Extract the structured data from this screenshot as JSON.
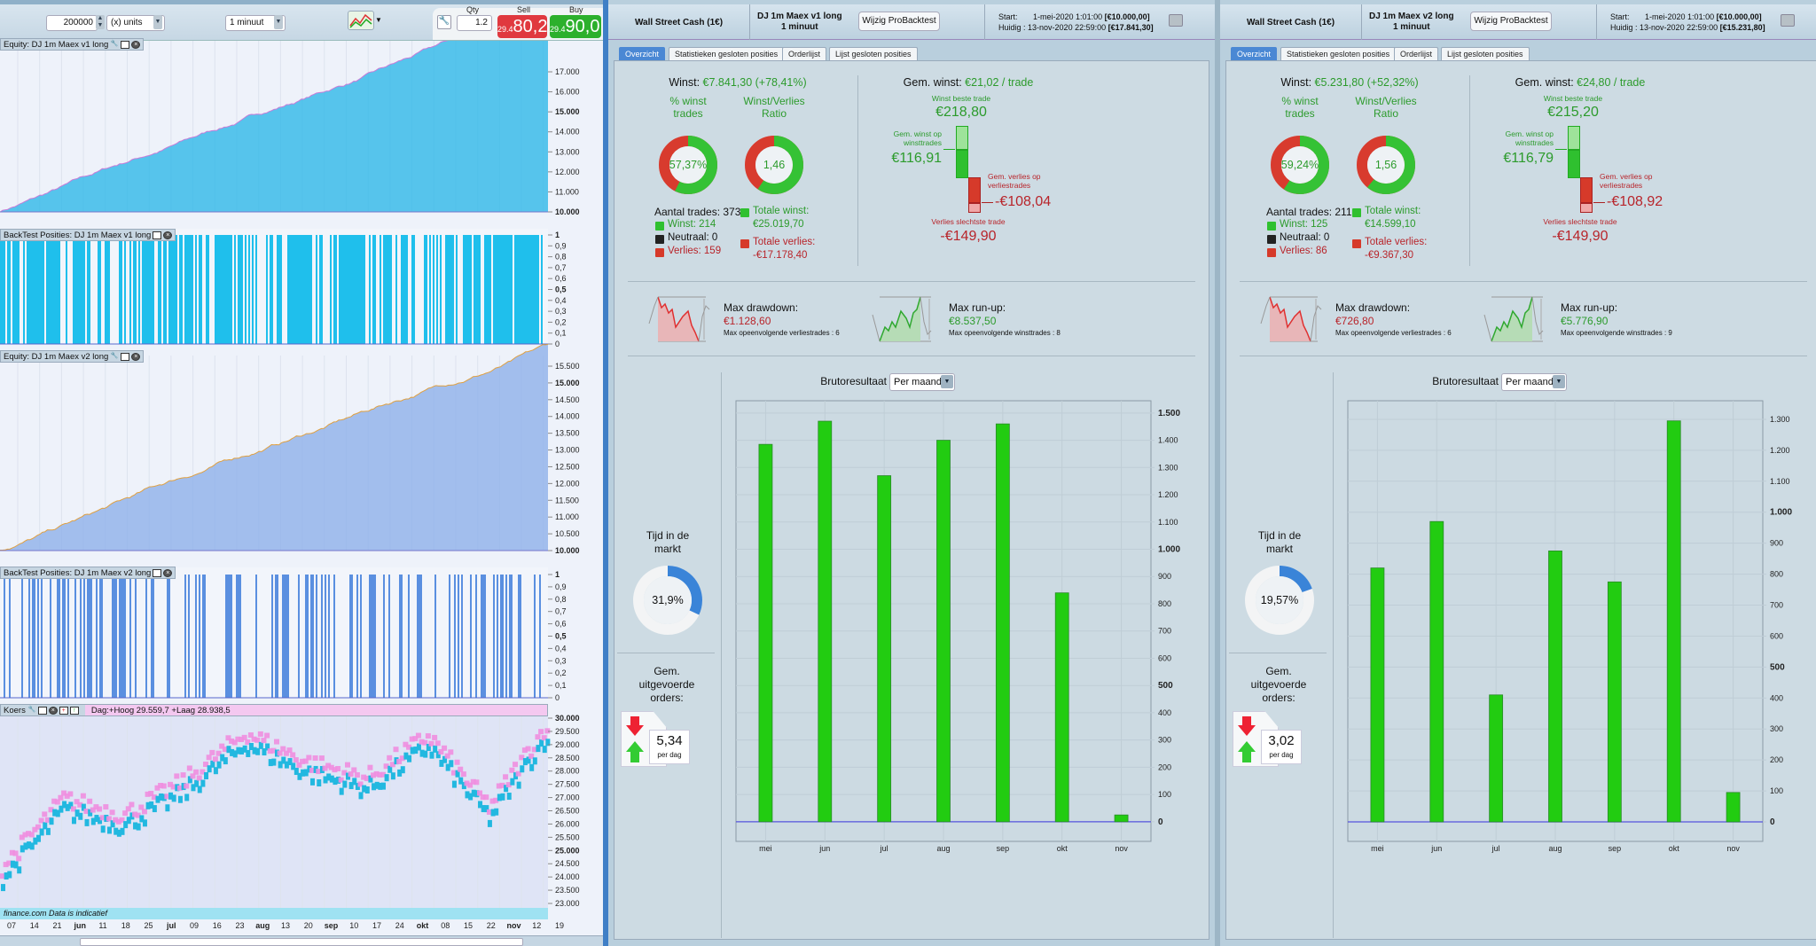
{
  "toolbar": {
    "quantity": "200000",
    "units": "(x) units",
    "timeframe": "1 minuut",
    "qty_label": "Qty",
    "qty_value": "1.2",
    "sell_label": "Sell",
    "buy_label": "Buy",
    "sell_prefix": "29.4",
    "sell_price": "80,2",
    "buy_prefix": "29.4",
    "buy_price": "90,0"
  },
  "left_charts": {
    "equity_v1_title": "Equity: DJ 1m Maex v1 long",
    "equity_v1_ticks": [
      "17.000",
      "16.000",
      "15.000",
      "14.000",
      "13.000",
      "12.000",
      "11.000",
      "10.000"
    ],
    "positions_v1_title": "BackTest Posities: DJ 1m Maex v1 long",
    "positions_ticks": [
      "1",
      "0,9",
      "0,8",
      "0,7",
      "0,6",
      "0,5",
      "0,4",
      "0,3",
      "0,2",
      "0,1",
      "0"
    ],
    "equity_v2_title": "Equity: DJ 1m Maex v2 long",
    "equity_v2_ticks": [
      "15.500",
      "15.000",
      "14.500",
      "14.000",
      "13.500",
      "13.000",
      "12.500",
      "12.000",
      "11.500",
      "11.000",
      "10.500",
      "10.000"
    ],
    "positions_v2_title": "BackTest Posities: DJ 1m Maex v2 long",
    "price_title": "Koers",
    "price_info": "Dag:+Hoog 29.559,7 +Laag 28.938,5",
    "price_ticks": [
      "30.000",
      "29.500",
      "29.000",
      "28.500",
      "28.000",
      "27.500",
      "27.000",
      "26.500",
      "26.000",
      "25.500",
      "25.000",
      "24.500",
      "24.000",
      "23.500",
      "23.000"
    ],
    "footer_note": "finance.com  Data is indicatief",
    "date_ticks": [
      "07",
      "14",
      "21",
      "jun",
      "11",
      "18",
      "25",
      "jul",
      "09",
      "16",
      "23",
      "aug",
      "13",
      "20",
      "sep",
      "10",
      "17",
      "24",
      "okt",
      "08",
      "15",
      "22",
      "nov",
      "12",
      "19"
    ],
    "colors": {
      "equity_v1": "#2fb8e8",
      "equity_v2": "#8fb0ea",
      "positions_v1": "#1fbfec",
      "positions_v2": "#5a8fe0",
      "candles_up": "#f08ee0",
      "candles_down": "#22b8e0"
    }
  },
  "panels": [
    {
      "instrument": "Wall Street Cash (1€)",
      "system": "DJ 1m Maex v1 long",
      "timeframe": "1 minuut",
      "edit_button": "Wijzig ProBacktest",
      "start_label": "Start:",
      "start_value": "1-mei-2020 1:01:00",
      "start_capital": "[€10.000,00]",
      "current_label": "Huidig :",
      "current_value": "13-nov-2020 22:59:00",
      "current_capital": "[€17.841,30]",
      "tabs": [
        "Overzicht",
        "Statistieken gesloten posities",
        "Orderlijst",
        "Lijst gesloten posities"
      ],
      "profit_label": "Winst:",
      "profit_value": "€7.841,30 (+78,41%)",
      "win_pct_title_1": "% winst",
      "win_pct_title_2": "trades",
      "win_pct": "57,37%",
      "win_fraction": 0.5737,
      "ratio_title_1": "Winst/Verlies",
      "ratio_title_2": "Ratio",
      "ratio": "1,46",
      "ratio_value": 1.46,
      "trades_count": "Aantal trades: 373",
      "wins": "Winst: 214",
      "neutral": "Neutraal: 0",
      "losses": "Verlies: 159",
      "total_win_label": "Totale winst:",
      "total_win": "€25.019,70",
      "total_loss_label": "Totale verlies:",
      "total_loss": "-€17.178,40",
      "avg_profit_label": "Gem. winst:",
      "avg_profit": "€21,02 / trade",
      "best_trade_label": "Winst beste trade",
      "best_trade": "€218,80",
      "avg_win_label_1": "Gem. winst op",
      "avg_win_label_2": "winsttrades",
      "avg_win": "€116,91",
      "avg_loss_label_1": "Gem. verlies op",
      "avg_loss_label_2": "verliestrades",
      "avg_loss": "-€108,04",
      "worst_trade_label": "Verlies slechtste trade",
      "worst_trade": "-€149,90",
      "drawdown_label": "Max drawdown:",
      "drawdown": "€1.128,60",
      "drawdown_sub": "Max opeenvolgende verliestrades : 6",
      "runup_label": "Max run-up:",
      "runup": "€8.537,50",
      "runup_sub": "Max opeenvolgende winsttrades : 8",
      "time_in_market_1": "Tijd in de",
      "time_in_market_2": "markt",
      "time_in_market": "31,9%",
      "time_in_market_fraction": 0.319,
      "orders_label_1": "Gem.",
      "orders_label_2": "uitgevoerde",
      "orders_label_3": "orders:",
      "orders_per_day": "5,34",
      "orders_unit": "per dag",
      "chart_title": "Brutoresultaat",
      "chart_period": "Per maand"
    },
    {
      "instrument": "Wall Street Cash (1€)",
      "system": "DJ 1m Maex v2 long",
      "timeframe": "1 minuut",
      "edit_button": "Wijzig ProBacktest",
      "start_label": "Start:",
      "start_value": "1-mei-2020 1:01:00",
      "start_capital": "[€10.000,00]",
      "current_label": "Huidig :",
      "current_value": "13-nov-2020 22:59:00",
      "current_capital": "[€15.231,80]",
      "tabs": [
        "Overzicht",
        "Statistieken gesloten posities",
        "Orderlijst",
        "Lijst gesloten posities"
      ],
      "profit_label": "Winst:",
      "profit_value": "€5.231,80 (+52,32%)",
      "win_pct_title_1": "% winst",
      "win_pct_title_2": "trades",
      "win_pct": "59,24%",
      "win_fraction": 0.5924,
      "ratio_title_1": "Winst/Verlies",
      "ratio_title_2": "Ratio",
      "ratio": "1,56",
      "ratio_value": 1.56,
      "trades_count": "Aantal trades: 211",
      "wins": "Winst: 125",
      "neutral": "Neutraal: 0",
      "losses": "Verlies: 86",
      "total_win_label": "Totale winst:",
      "total_win": "€14.599,10",
      "total_loss_label": "Totale verlies:",
      "total_loss": "-€9.367,30",
      "avg_profit_label": "Gem. winst:",
      "avg_profit": "€24,80 / trade",
      "best_trade_label": "Winst beste trade",
      "best_trade": "€215,20",
      "avg_win_label_1": "Gem. winst op",
      "avg_win_label_2": "winsttrades",
      "avg_win": "€116,79",
      "avg_loss_label_1": "Gem. verlies op",
      "avg_loss_label_2": "verliestrades",
      "avg_loss": "-€108,92",
      "worst_trade_label": "Verlies slechtste trade",
      "worst_trade": "-€149,90",
      "drawdown_label": "Max drawdown:",
      "drawdown": "€726,80",
      "drawdown_sub": "Max opeenvolgende verliestrades : 6",
      "runup_label": "Max run-up:",
      "runup": "€5.776,90",
      "runup_sub": "Max opeenvolgende winsttrades : 9",
      "time_in_market_1": "Tijd in de",
      "time_in_market_2": "markt",
      "time_in_market": "19,57%",
      "time_in_market_fraction": 0.1957,
      "orders_label_1": "Gem.",
      "orders_label_2": "uitgevoerde",
      "orders_label_3": "orders:",
      "orders_per_day": "3,02",
      "orders_unit": "per dag",
      "chart_title": "Brutoresultaat",
      "chart_period": "Per maand"
    }
  ],
  "chart_data": [
    {
      "type": "bar",
      "title": "Brutoresultaat",
      "categories": [
        "mei",
        "jun",
        "jul",
        "aug",
        "sep",
        "okt",
        "nov"
      ],
      "values": [
        1385,
        1470,
        1270,
        1400,
        1460,
        840,
        25
      ],
      "yticks": [
        "1.500",
        "1.400",
        "1.300",
        "1.200",
        "1.100",
        "1.000",
        "900",
        "800",
        "700",
        "600",
        "500",
        "400",
        "300",
        "200",
        "100",
        "0"
      ],
      "ylim": [
        -72,
        1545
      ],
      "grid": true,
      "bar_color": "#22cc11"
    },
    {
      "type": "bar",
      "title": "Brutoresultaat",
      "categories": [
        "mei",
        "jun",
        "jul",
        "aug",
        "sep",
        "okt",
        "nov"
      ],
      "values": [
        820,
        970,
        410,
        875,
        775,
        1295,
        95
      ],
      "yticks": [
        "1.300",
        "1.200",
        "1.100",
        "1.000",
        "900",
        "800",
        "700",
        "600",
        "500",
        "400",
        "300",
        "200",
        "100",
        "0"
      ],
      "ylim": [
        -63,
        1360
      ],
      "grid": true,
      "bar_color": "#22cc11"
    }
  ]
}
